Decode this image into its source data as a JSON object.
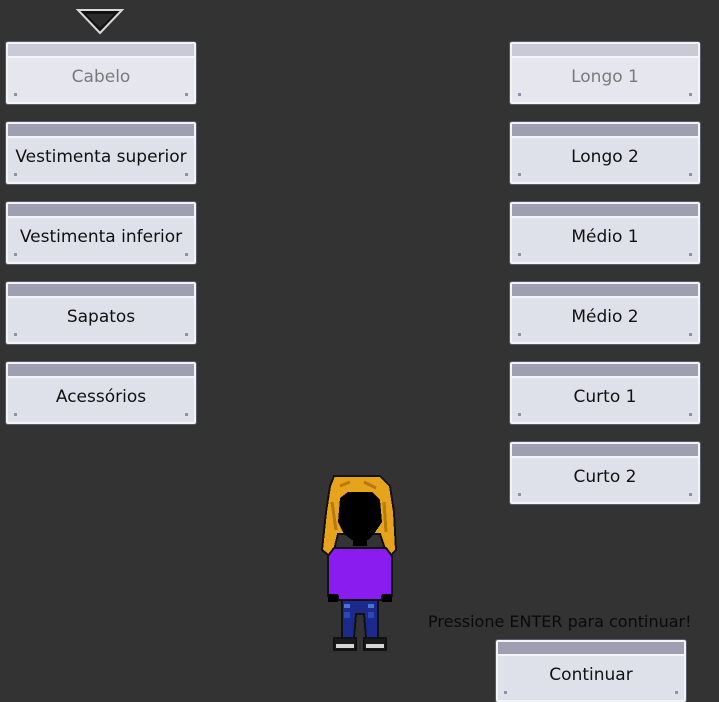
{
  "categories": [
    {
      "label": "Cabelo",
      "selected": true
    },
    {
      "label": "Vestimenta superior",
      "selected": false
    },
    {
      "label": "Vestimenta inferior",
      "selected": false
    },
    {
      "label": "Sapatos",
      "selected": false
    },
    {
      "label": "Acessórios",
      "selected": false
    }
  ],
  "options": [
    {
      "label": "Longo 1",
      "selected": true
    },
    {
      "label": "Longo 2",
      "selected": false
    },
    {
      "label": "Médio 1",
      "selected": false
    },
    {
      "label": "Médio 2",
      "selected": false
    },
    {
      "label": "Curto 1",
      "selected": false
    },
    {
      "label": "Curto 2",
      "selected": false
    }
  ],
  "prompt": "Pressione ENTER para continuar!",
  "continue_label": "Continuar",
  "icons": {
    "selector": "triangle-down-icon",
    "avatar": "character-preview"
  },
  "colors": {
    "background": "#333333",
    "button_face": "#dfe1ea",
    "button_strip": "#9e9fb2",
    "hair": "#e8a31c",
    "shirt": "#8a1cf0",
    "pants": "#1c2a8c"
  }
}
